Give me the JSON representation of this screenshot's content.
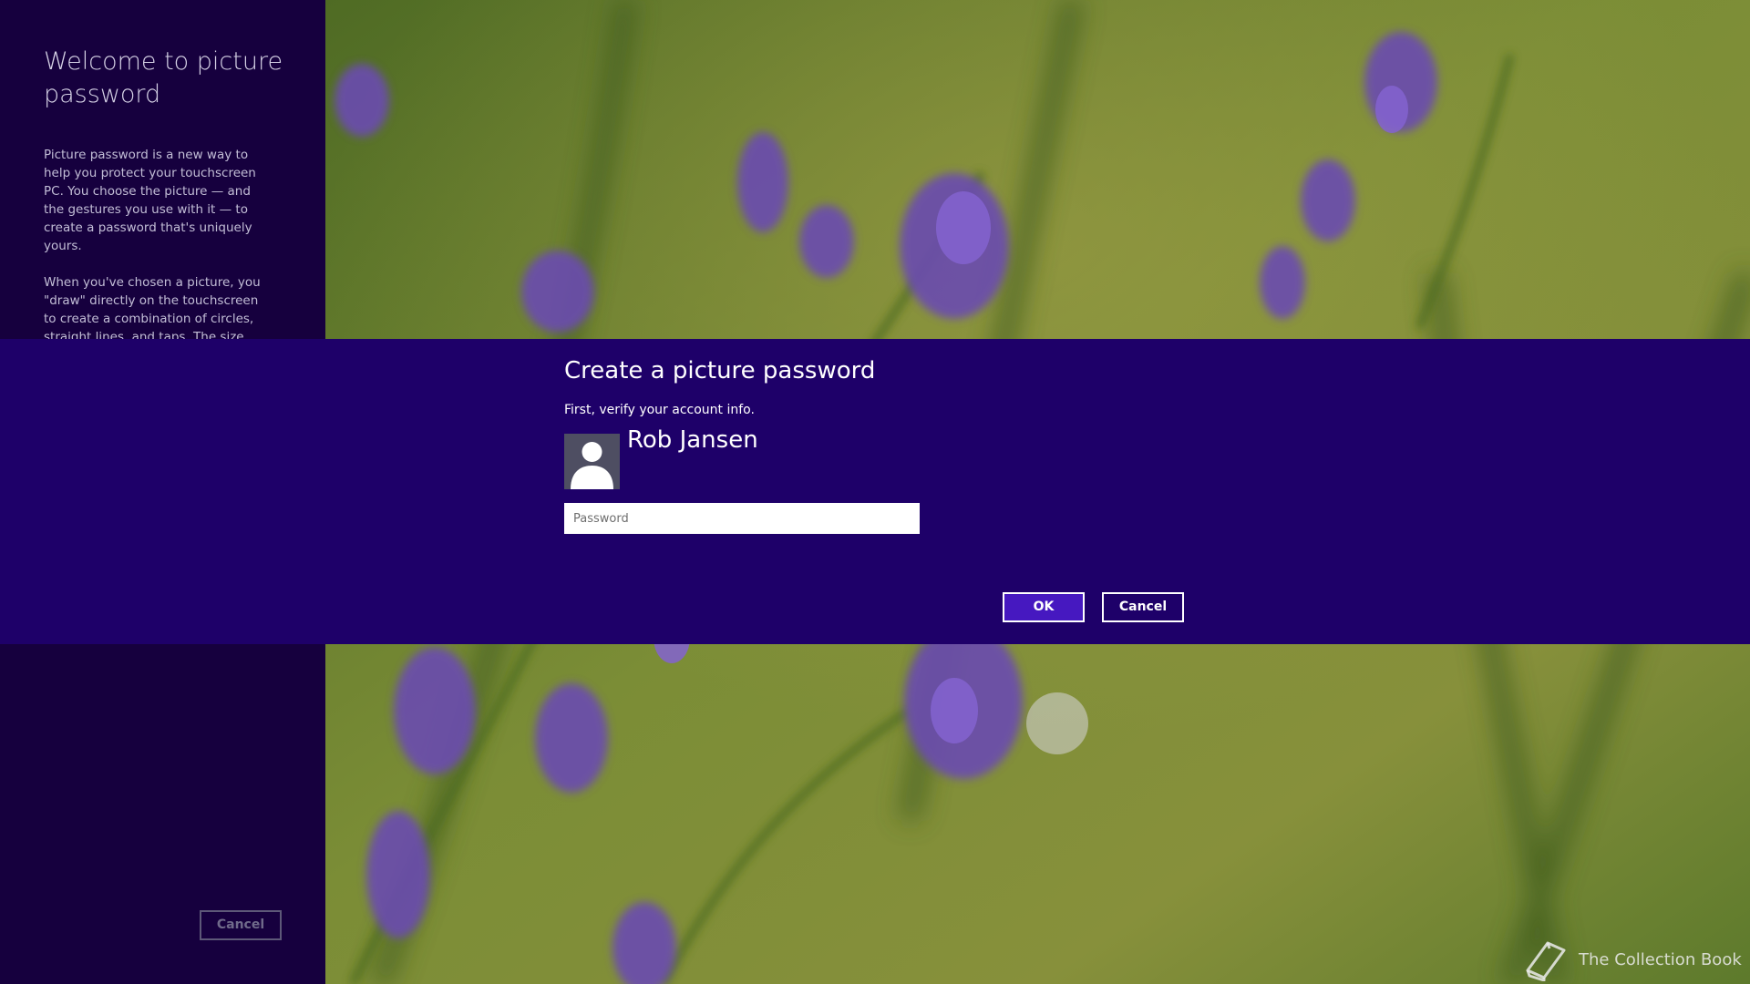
{
  "left_pane": {
    "title": "Welcome to picture password",
    "paragraph_1": "Picture password is a new way to help you protect your touchscreen PC. You choose the picture — and the gestures you use with it — to create a password that's uniquely yours.",
    "paragraph_2": "When you've chosen a picture, you \"draw\" directly on the touchscreen to create a combination of circles, straight lines, and taps. The size, position, and direction of your gestures become part",
    "cancel_label": "Cancel"
  },
  "dialog": {
    "title": "Create a picture password",
    "subtitle": "First, verify your account info.",
    "account_name": "Rob Jansen",
    "password_placeholder": "Password",
    "password_value": "",
    "ok_label": "OK",
    "cancel_label": "Cancel"
  },
  "watermark": {
    "text": "The Collection Book",
    "icon": "book-icon"
  },
  "colors": {
    "dialog_band": "#1e0069",
    "left_pane": "#16003e",
    "ok_button": "#4618c0",
    "text": "#ffffff"
  }
}
